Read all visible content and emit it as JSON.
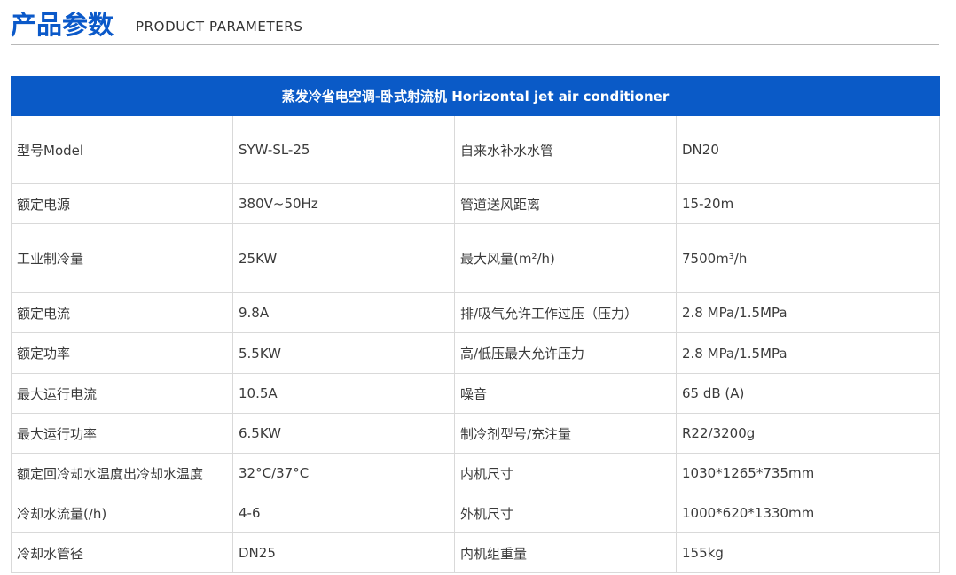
{
  "header": {
    "title_cn": "产品参数",
    "title_en": "PRODUCT PARAMETERS"
  },
  "table": {
    "caption": "蒸发冷省电空调-卧式射流机 Horizontal jet air conditioner",
    "rows": [
      [
        "型号Model",
        "SYW-SL-25",
        "自来水补水水管",
        "DN20"
      ],
      [
        "额定电源",
        "380V~50Hz",
        "管道送风距离",
        "15-20m"
      ],
      [
        "工业制冷量",
        "25KW",
        "最大风量(m²/h)",
        "7500m³/h"
      ],
      [
        "额定电流",
        "9.8A",
        "排/吸气允许工作过压（压力）",
        "2.8 MPa/1.5MPa"
      ],
      [
        "额定功率",
        "5.5KW",
        "高/低压最大允许压力",
        "2.8 MPa/1.5MPa"
      ],
      [
        "最大运行电流",
        "10.5A",
        "噪音",
        "65 dB (A)"
      ],
      [
        "最大运行功率",
        "6.5KW",
        "制冷剂型号/充注量",
        "R22/3200g"
      ],
      [
        "额定回冷却水温度出冷却水温度",
        "32°C/37°C",
        "内机尺寸",
        "1030*1265*735mm"
      ],
      [
        "冷却水流量(/h)",
        "4-6",
        "外机尺寸",
        "1000*620*1330mm"
      ],
      [
        "冷却水管径",
        "DN25",
        "内机组重量",
        "155kg"
      ]
    ]
  },
  "colors": {
    "accent": "#0b59c9",
    "table_header_bg": "#0a5ac7",
    "border": "#d9d9d9"
  }
}
